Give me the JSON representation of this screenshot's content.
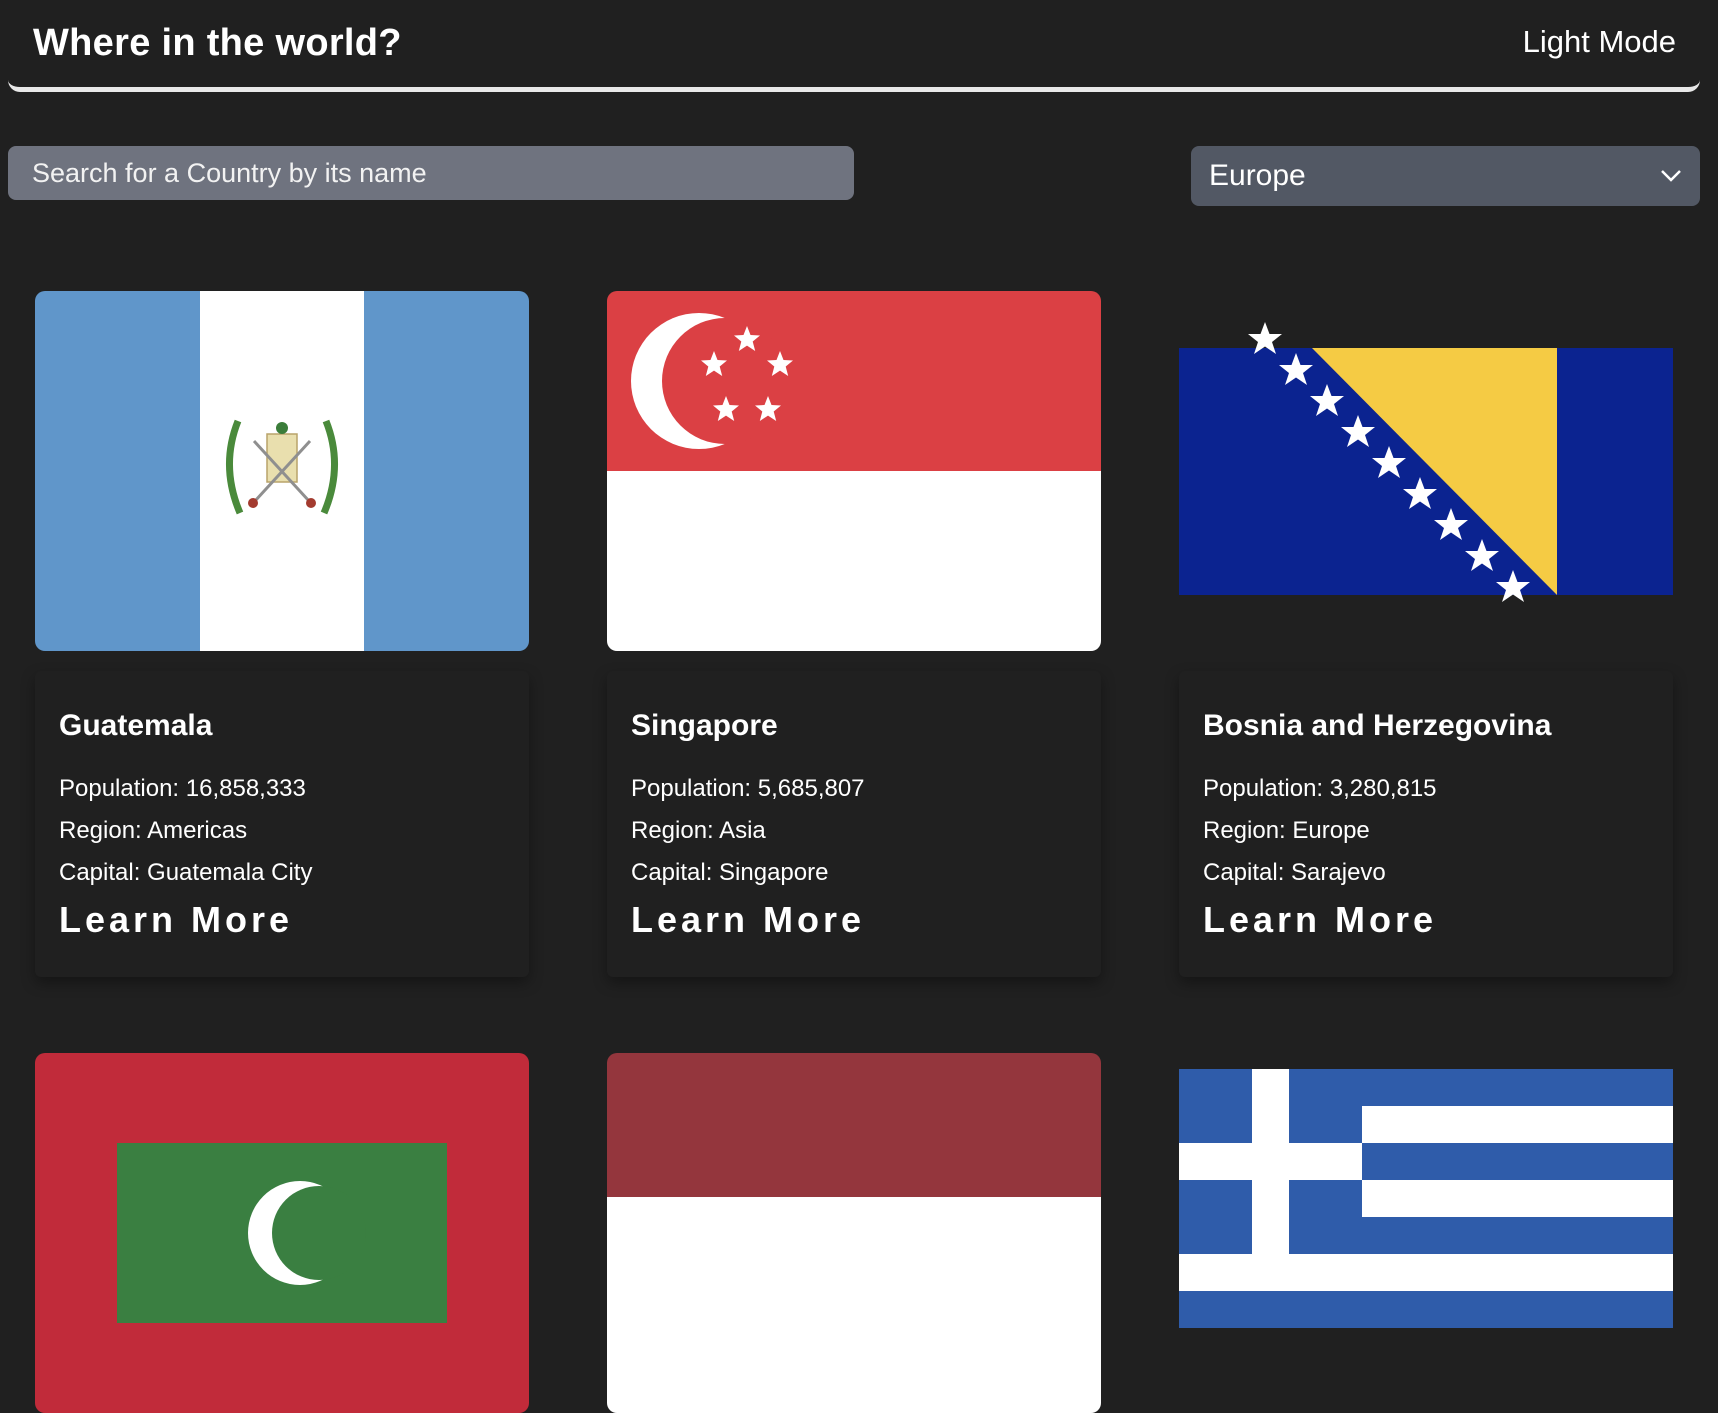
{
  "header": {
    "title": "Where in the world?",
    "mode_toggle": "Light Mode"
  },
  "search": {
    "placeholder": "Search for a Country by its name"
  },
  "filter": {
    "selected": "Europe"
  },
  "cards": [
    {
      "name": "Guatemala",
      "population": "Population: 16,858,333",
      "region": "Region: Americas",
      "capital": "Capital: Guatemala City",
      "cta": "Learn More",
      "flag_icon": "guatemala-flag"
    },
    {
      "name": "Singapore",
      "population": "Population: 5,685,807",
      "region": "Region: Asia",
      "capital": "Capital: Singapore",
      "cta": "Learn More",
      "flag_icon": "singapore-flag"
    },
    {
      "name": "Bosnia and Herzegovina",
      "population": "Population: 3,280,815",
      "region": "Region: Europe",
      "capital": "Capital: Sarajevo",
      "cta": "Learn More",
      "flag_icon": "bosnia-flag"
    },
    {
      "flag_icon": "maldives-flag"
    },
    {
      "flag_icon": "indonesia-flag"
    },
    {
      "flag_icon": "greece-flag"
    }
  ],
  "colors": {
    "background": "#202020",
    "search_bg": "#6f737f",
    "select_bg": "#525864",
    "text": "#ffffff"
  }
}
